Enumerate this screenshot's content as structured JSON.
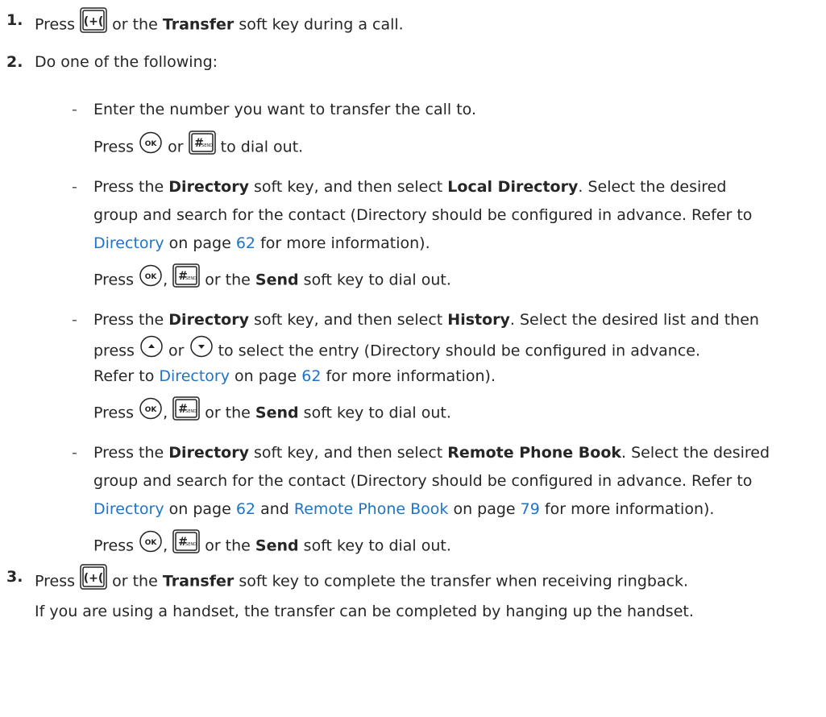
{
  "colors": {
    "text": "#262626",
    "link": "#1f74c6",
    "icon_stroke": "#222222"
  },
  "icons": {
    "transfer": "transfer-key-icon",
    "ok": "ok-key-icon",
    "send": "send-key-icon",
    "up": "up-arrow-key-icon",
    "down": "down-arrow-key-icon"
  },
  "step1": {
    "num": "1.",
    "press": "Press",
    "t1": "or the",
    "transfer": "Transfer",
    "t2": "soft key during a call."
  },
  "step2": {
    "num": "2.",
    "text": "Do one of the following:",
    "opt1": {
      "dash": "-",
      "line1": "Enter the number you want to transfer the call to.",
      "press": "Press",
      "or": "or",
      "dial": "to dial out."
    },
    "opt2": {
      "dash": "-",
      "press": "Press the",
      "directory": "Directory",
      "select": "soft key, and then select",
      "local": "Local Directory",
      "rest1": ". Select the desired",
      "line2": "group and search for the contact (Directory should be configured in advance. Refer to",
      "link": "Directory",
      "onpage": "on page",
      "page": "62",
      "more": "for more information).",
      "press2": "Press",
      "comma": ",",
      "orthe": "or the",
      "send": "Send",
      "dial": "soft key to dial out."
    },
    "opt3": {
      "dash": "-",
      "press": "Press the",
      "directory": "Directory",
      "select": "soft key, and then select",
      "history": "History",
      "rest1": ". Select the desired list and then",
      "pressl": "press",
      "or": "or",
      "rest2": "to select the entry (Directory should be configured in advance.",
      "refer": "Refer to",
      "link": "Directory",
      "onpage": "on page",
      "page": "62",
      "more": "for more information).",
      "press2": "Press",
      "comma": ",",
      "orthe": "or the",
      "send": "Send",
      "dial": "soft key to dial out."
    },
    "opt4": {
      "dash": "-",
      "press": "Press the",
      "directory": "Directory",
      "select": "soft key, and then select",
      "remote": "Remote Phone Book",
      "rest1": ". Select the desired",
      "line2": "group and search for the contact (Directory should be configured in advance. Refer to",
      "link1": "Directory",
      "onpage1": "on page",
      "page1": "62",
      "and": "and",
      "link2": "Remote Phone Book",
      "onpage2": "on page",
      "page2": "79",
      "more": "for more information).",
      "press2": "Press",
      "comma": ",",
      "orthe": "or the",
      "send": "Send",
      "dial": "soft key to dial out."
    }
  },
  "step3": {
    "num": "3.",
    "press": "Press",
    "t1": "or the",
    "transfer": "Transfer",
    "t2": "soft key to complete the transfer when receiving ringback.",
    "note": "If you are using a handset, the transfer can be completed by hanging up the handset."
  }
}
